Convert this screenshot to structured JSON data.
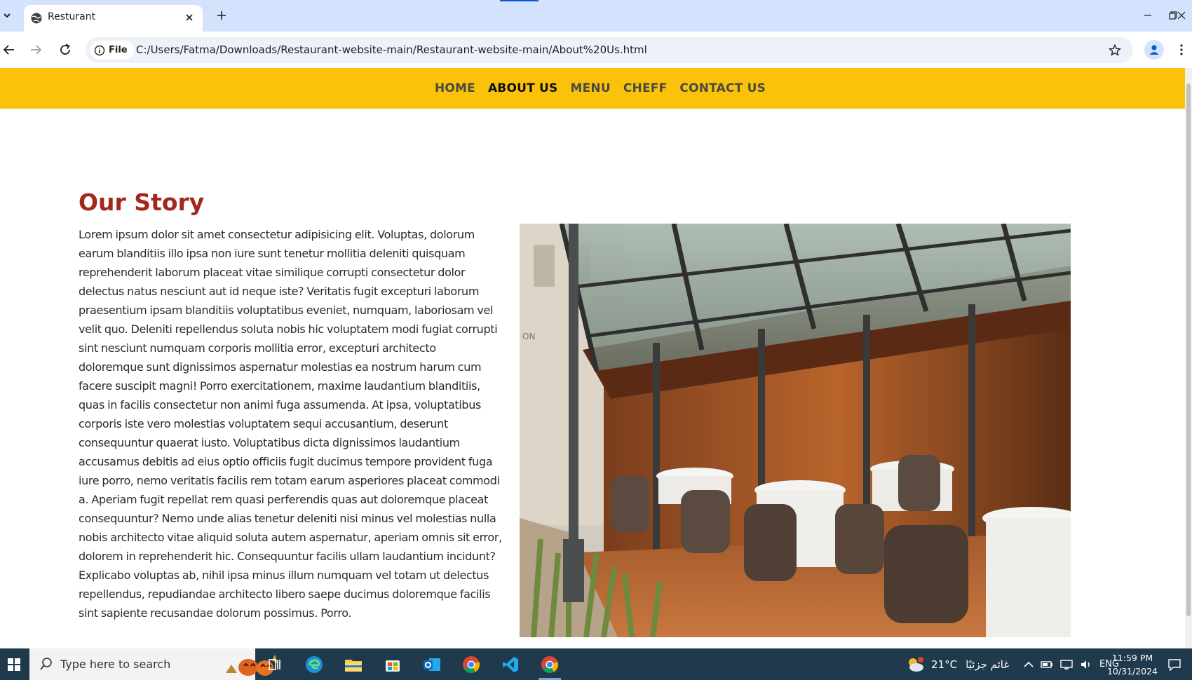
{
  "browser": {
    "tab_title": "Resturant",
    "chip_label": "File",
    "url": "C:/Users/Fatma/Downloads/Restaurant-website-main/Restaurant-website-main/About%20Us.html"
  },
  "site": {
    "nav": [
      {
        "label": "HOME",
        "active": false
      },
      {
        "label": "ABOUT US",
        "active": true
      },
      {
        "label": "MENU",
        "active": false
      },
      {
        "label": "CHEFF",
        "active": false
      },
      {
        "label": "CONTACT US",
        "active": false
      }
    ],
    "story_title": "Our Story",
    "story_text": "Lorem ipsum dolor sit amet consectetur adipisicing elit. Voluptas, dolorum earum blanditiis illo ipsa non iure sunt tenetur mollitia deleniti quisquam reprehenderit laborum placeat vitae similique corrupti consectetur dolor delectus natus nesciunt aut id neque iste? Veritatis fugit excepturi laborum praesentium ipsam blanditiis voluptatibus eveniet, numquam, laboriosam vel velit quo. Deleniti repellendus soluta nobis hic voluptatem modi fugiat corrupti sint nesciunt numquam corporis mollitia error, excepturi architecto doloremque sunt dignissimos aspernatur molestias ea nostrum harum cum facere suscipit magni! Porro exercitationem, maxime laudantium blanditiis, quas in facilis consectetur non animi fuga assumenda. At ipsa, voluptatibus corporis iste vero molestias voluptatem sequi accusantium, deserunt consequuntur quaerat iusto. Voluptatibus dicta dignissimos laudantium accusamus debitis ad eius optio officiis fugit ducimus tempore provident fuga iure porro, nemo veritatis facilis rem totam earum asperiores placeat commodi a. Aperiam fugit repellat rem quasi perferendis quas aut doloremque placeat consequuntur? Nemo unde alias tenetur deleniti nisi minus vel molestias nulla nobis architecto vitae aliquid soluta autem aspernatur, aperiam omnis sit error, dolorem in reprehenderit hic. Consequuntur facilis ullam laudantium incidunt? Explicabo voluptas ab, nihil ipsa minus illum numquam vel totam ut delectus repellendus, repudiandae architecto libero saepe ducimus doloremque facilis sint sapiente recusandae dolorum possimus. Porro."
  },
  "taskbar": {
    "search_placeholder": "Type here to search",
    "weather_temp": "21°C",
    "weather_desc": "غائم جزئيًا",
    "language": "ENG",
    "time": "11:59 PM",
    "date": "10/31/2024"
  },
  "colors": {
    "nav_bg": "#fbc20c",
    "title_red": "#a3281c",
    "tabstrip": "#d3e3fd",
    "taskbar": "#1f3a4d"
  }
}
